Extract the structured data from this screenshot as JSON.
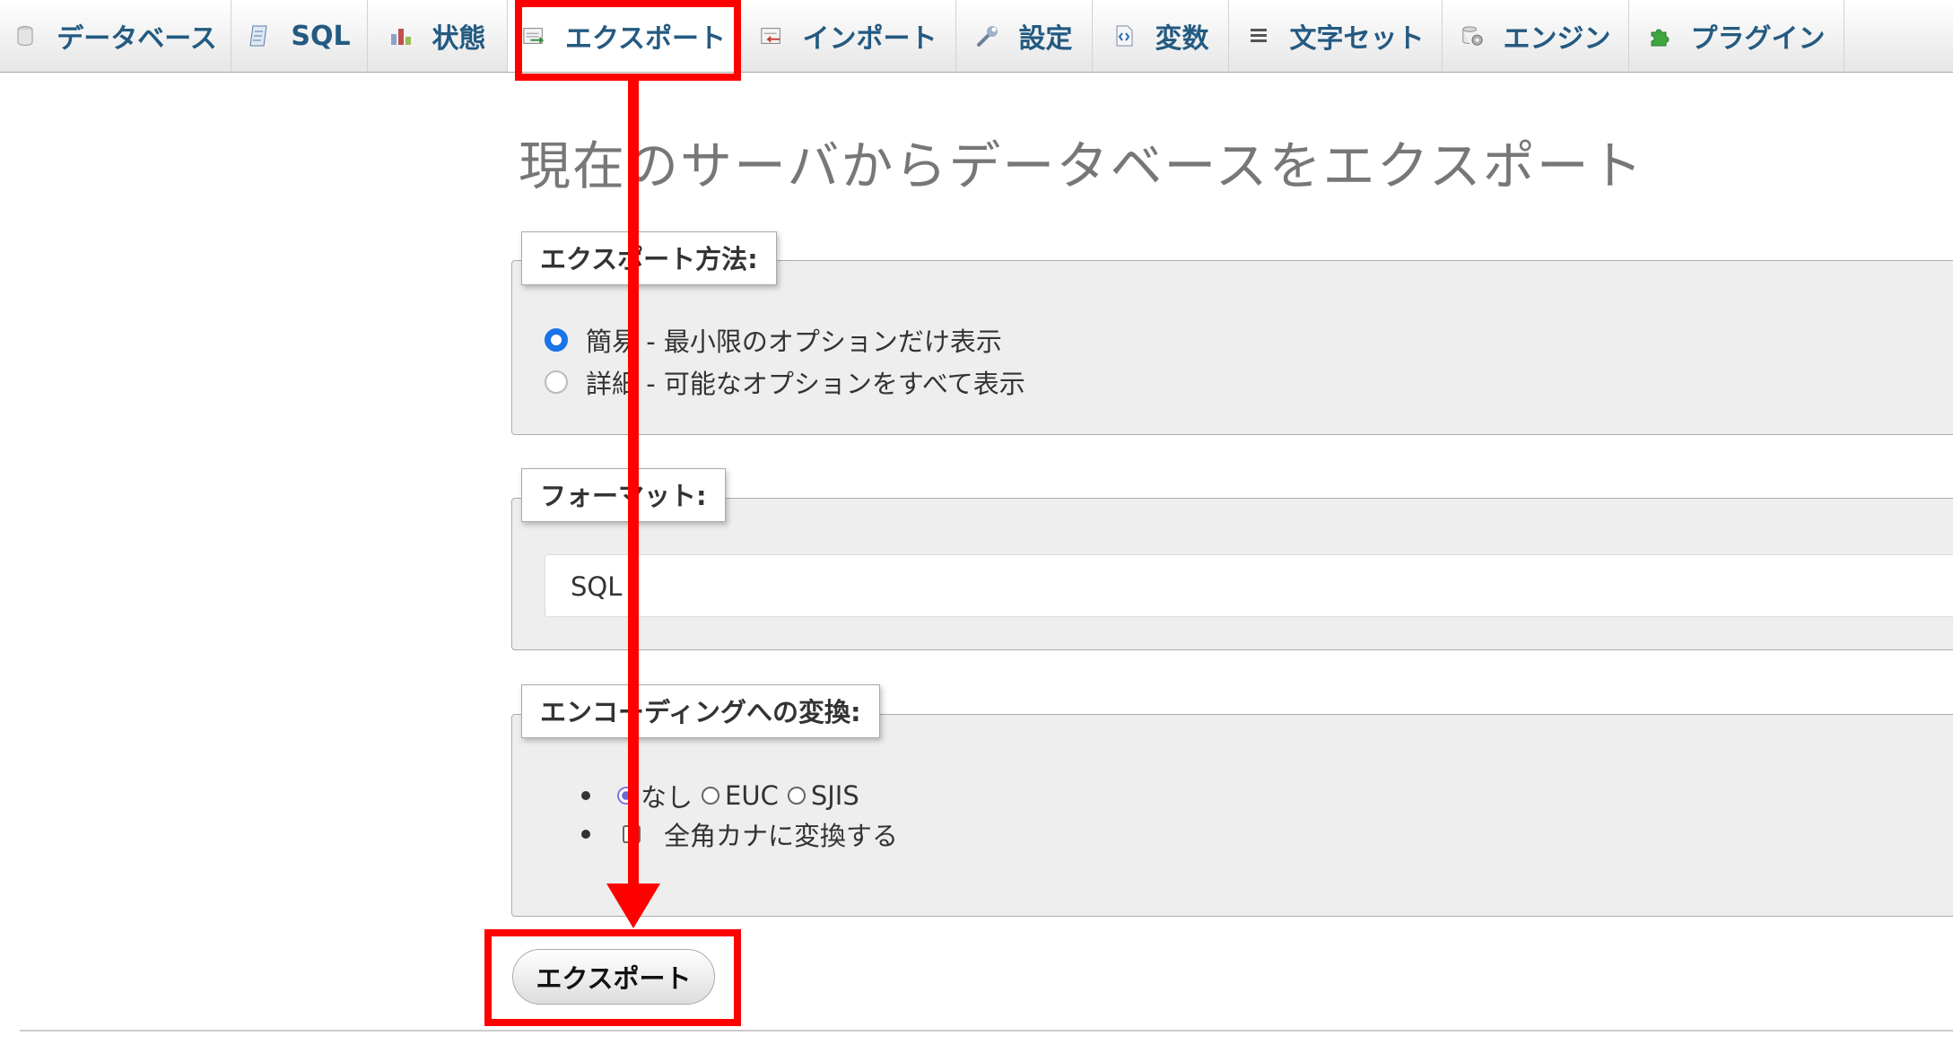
{
  "tabs": [
    {
      "label": "データベース",
      "icon": "database-icon"
    },
    {
      "label": "SQL",
      "icon": "sql-icon"
    },
    {
      "label": "状態",
      "icon": "status-icon"
    },
    {
      "label": "エクスポート",
      "icon": "export-icon",
      "active": true
    },
    {
      "label": "インポート",
      "icon": "import-icon"
    },
    {
      "label": "設定",
      "icon": "wrench-icon"
    },
    {
      "label": "変数",
      "icon": "variables-icon"
    },
    {
      "label": "文字セット",
      "icon": "charset-icon"
    },
    {
      "label": "エンジン",
      "icon": "engine-icon"
    },
    {
      "label": "プラグイン",
      "icon": "plugin-icon"
    }
  ],
  "page_title": "現在のサーバからデータベースをエクスポート",
  "export_method": {
    "legend": "エクスポート方法:",
    "options": [
      {
        "label": "簡易 - 最小限のオプションだけ表示",
        "selected": true
      },
      {
        "label": "詳細 - 可能なオプションをすべて表示",
        "selected": false
      }
    ]
  },
  "format": {
    "legend": "フォーマット:",
    "selected": "SQL"
  },
  "encoding": {
    "legend": "エンコーディングへの変換:",
    "options": [
      {
        "label": "なし",
        "selected": true
      },
      {
        "label": "EUC",
        "selected": false
      },
      {
        "label": "SJIS",
        "selected": false
      }
    ],
    "kana_checkbox_label": "全角カナに変換する",
    "kana_checked": false
  },
  "export_button_label": "エクスポート",
  "annotation_color": "#ff0000"
}
